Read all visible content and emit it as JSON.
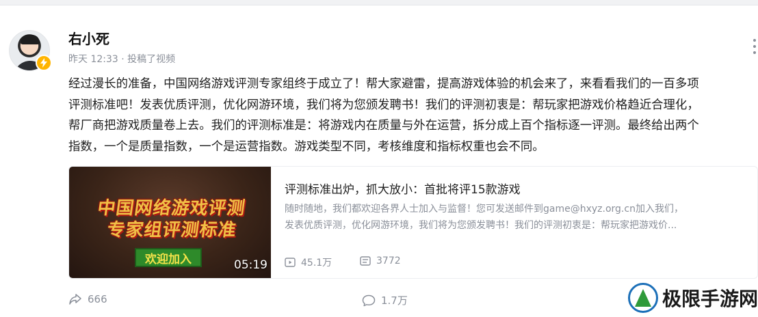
{
  "post": {
    "author": "右小死",
    "meta": "昨天 12:33 · 投稿了视频",
    "text_lines": [
      "经过漫长的准备，中国网络游戏评测专家组终于成立了！帮大家避雷，提高游戏体验的机会来了，来看看我们的一百多项",
      "评测标准吧！发表优质评测，优化网游环境，我们将为您颁发聘书！我们的评测初衷是：帮玩家把游戏价格趋近合理化，",
      "帮厂商把游戏质量卷上去。我们的评测标准是：将游戏内在质量与外在运营，拆分成上百个指标逐一评测。最终给出两个",
      "指数，一个是质量指数，一个是运营指数。游戏类型不同，考核维度和指标权重也会不同。"
    ]
  },
  "video": {
    "thumb_line1": "中国网络游戏评测",
    "thumb_line2": "专家组评测标准",
    "thumb_button": "欢迎加入",
    "duration": "05:19",
    "title": "评测标准出炉，抓大放小：首批将评15款游戏",
    "desc_lines": [
      "随时随地，我们都欢迎各界人士加入与监督！您可发送邮件到game@hxyz.org.cn加入我们，",
      "发表优质评测，优化网游环境，我们将为您颁发聘书！我们的评测初衷是：帮玩家把游戏价..."
    ],
    "views": "45.1万",
    "danmaku": "3772"
  },
  "actions": {
    "share": "666",
    "comment": "1.7万"
  },
  "watermark": "极限手游网",
  "icons": [
    "lightning-icon",
    "more-icon",
    "play-count-icon",
    "danmaku-icon",
    "share-icon",
    "comment-icon"
  ],
  "colors": {
    "badge": "#ffb400",
    "muted": "#8a8f99"
  }
}
